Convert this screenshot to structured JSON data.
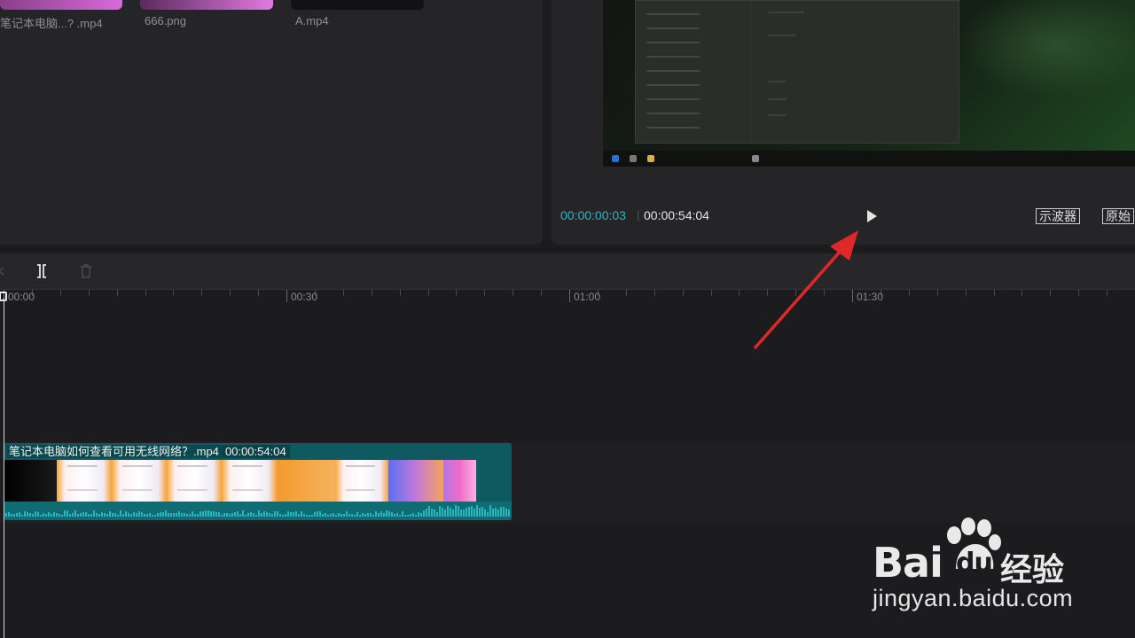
{
  "media": {
    "items": [
      {
        "label": "笔记本电脑...?  .mp4"
      },
      {
        "label": "666.png"
      },
      {
        "label": "A.mp4"
      }
    ]
  },
  "player": {
    "current_time": "00:00:00:03",
    "separator": "|",
    "total_time": "00:00:54:04",
    "scope_label": "示波器",
    "original_label": "原始"
  },
  "timeline": {
    "ruler_labels": [
      "00:00",
      "00:30",
      "01:00",
      "01:30"
    ],
    "clip": {
      "title": "笔记本电脑如何查看可用无线网络？.mp4",
      "duration": "00:00:54:04"
    }
  },
  "watermark": {
    "brand": "Bai",
    "brand_suffix": "du",
    "brand_cn": "经验",
    "url": "jingyan.baidu.com"
  },
  "colors": {
    "timecode_accent": "#2fb6c9",
    "clip_bg": "#0e5a60",
    "annotation_arrow": "#e0282b"
  }
}
